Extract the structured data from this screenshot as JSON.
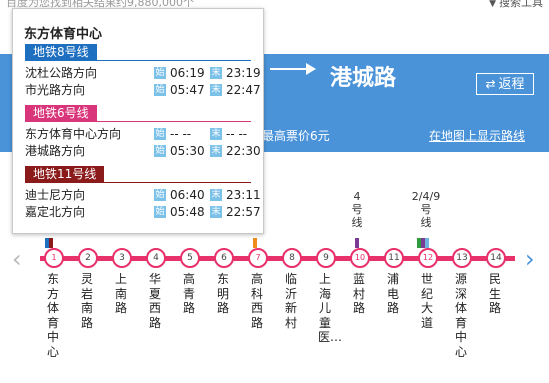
{
  "top": {
    "result_text": "百度为您找到相关结果约9,880,000个",
    "tools_label": "搜索工具"
  },
  "header": {
    "destination": "港城路",
    "return_label": "返程",
    "fare_text": "最高票价6元",
    "map_link": "在地图上显示路线",
    "accent": "#4a93d9"
  },
  "popup": {
    "title": "东方体育中心",
    "first_tag": "始",
    "last_tag": "末",
    "lines": [
      {
        "name": "地铁8号线",
        "color": "#1f6fc0",
        "rows": [
          {
            "dir": "沈杜公路方向",
            "first": "06:19",
            "last": "23:19"
          },
          {
            "dir": "市光路方向",
            "first": "05:47",
            "last": "22:47"
          }
        ]
      },
      {
        "name": "地铁6号线",
        "color": "#d9357a",
        "rows": [
          {
            "dir": "东方体育中心方向",
            "first": "-- --",
            "last": "-- --"
          },
          {
            "dir": "港城路方向",
            "first": "05:30",
            "last": "22:30"
          }
        ]
      },
      {
        "name": "地铁11号线",
        "color": "#8b1a1a",
        "rows": [
          {
            "dir": "迪士尼方向",
            "first": "06:40",
            "last": "23:11"
          },
          {
            "dir": "嘉定北方向",
            "first": "05:48",
            "last": "22:57"
          }
        ]
      }
    ]
  },
  "stations": [
    {
      "num": "1",
      "name": "东方体育中心",
      "xfer": true
    },
    {
      "num": "2",
      "name": "灵岩南路",
      "xfer": false
    },
    {
      "num": "3",
      "name": "上南路",
      "xfer": false
    },
    {
      "num": "4",
      "name": "华夏西路",
      "xfer": false
    },
    {
      "num": "5",
      "name": "高青路",
      "xfer": false
    },
    {
      "num": "6",
      "name": "东明路",
      "xfer": false
    },
    {
      "num": "7",
      "name": "高科西路",
      "xfer": true
    },
    {
      "num": "8",
      "name": "临沂新村",
      "xfer": false
    },
    {
      "num": "9",
      "name": "上海儿童医…",
      "xfer": false
    },
    {
      "num": "10",
      "name": "蓝村路",
      "xfer": true
    },
    {
      "num": "11",
      "name": "浦电路",
      "xfer": false
    },
    {
      "num": "12",
      "name": "世纪大道",
      "xfer": true
    },
    {
      "num": "13",
      "name": "源深体育中心",
      "xfer": false
    },
    {
      "num": "14",
      "name": "民生路",
      "xfer": false
    }
  ],
  "transfer_labels": [
    {
      "lines": "4",
      "suffix": "号线"
    },
    {
      "lines": "2/4/9",
      "suffix": "号线"
    }
  ],
  "colors": {
    "line6": "#e8306a",
    "line2": "#2e9b3d",
    "line4": "#7a3b92",
    "line9": "#6fb3e0",
    "line7": "#f08a1d",
    "line8": "#1f6fc0",
    "line11": "#8b1a1a"
  }
}
